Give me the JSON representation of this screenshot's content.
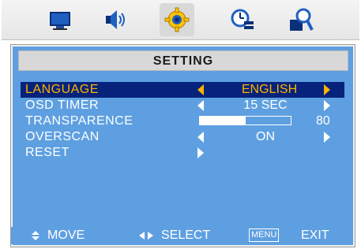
{
  "tabs": [
    {
      "name": "picture-icon"
    },
    {
      "name": "audio-icon"
    },
    {
      "name": "settings-gear-icon",
      "selected": true
    },
    {
      "name": "clock-icon"
    },
    {
      "name": "search-icon"
    }
  ],
  "panel": {
    "title": "SETTING",
    "rows": {
      "language": {
        "label": "LANGUAGE",
        "value": "ENGLISH"
      },
      "osd_timer": {
        "label": "OSD TIMER",
        "value": "15 SEC"
      },
      "transparence": {
        "label": "TRANSPARENCE",
        "level": 0.5,
        "value": "80"
      },
      "overscan": {
        "label": "OVERSCAN",
        "value": "ON"
      },
      "reset": {
        "label": "RESET"
      }
    }
  },
  "footer": {
    "move_label": "MOVE",
    "select_label": "SELECT",
    "menu_key": "MENU",
    "exit_label": "EXIT"
  },
  "colors": {
    "panel_bg": "#5d9fe0",
    "selection_bg": "#06227a",
    "selection_text": "#ffb300"
  }
}
